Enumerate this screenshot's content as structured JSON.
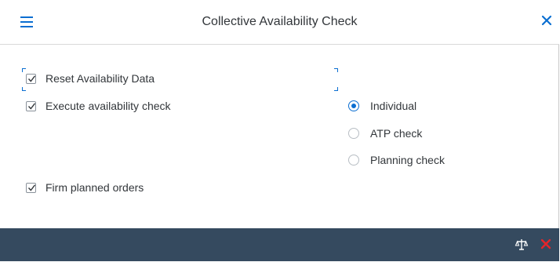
{
  "dialog": {
    "title": "Collective Availability Check",
    "menu_icon": "hamburger-menu-icon",
    "close_icon": "close-icon"
  },
  "options": {
    "reset_availability_data": {
      "label": "Reset Availability Data",
      "checked": true
    },
    "execute_availability_check": {
      "label": "Execute availability check",
      "checked": true
    },
    "firm_planned_orders": {
      "label": "Firm planned orders",
      "checked": true
    }
  },
  "check_type": {
    "selected": "Individual",
    "options": [
      {
        "label": "Individual",
        "selected": true
      },
      {
        "label": "ATP check",
        "selected": false
      },
      {
        "label": "Planning check",
        "selected": false
      }
    ]
  },
  "footer": {
    "buttons": [
      {
        "icon": "scales-icon"
      },
      {
        "icon": "cancel-icon"
      }
    ]
  },
  "colors": {
    "accent": "#0a6ed1",
    "footer_bg": "#354a5f",
    "cancel_red": "#e5252a"
  }
}
